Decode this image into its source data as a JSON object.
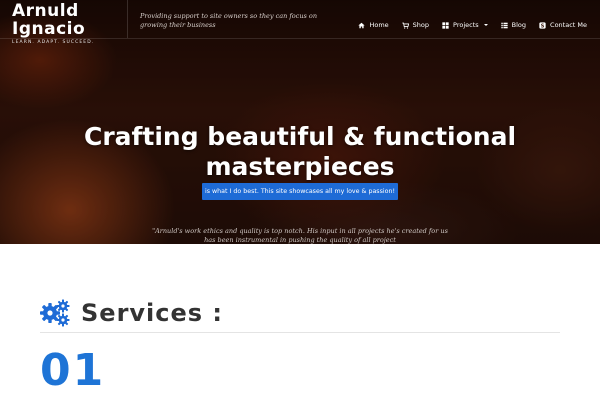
{
  "header": {
    "brand_name": "Arnuld Ignacio",
    "brand_tagline": "LEARN. ADAPT. SUCCEED.",
    "site_description": "Providing support to site owners so they can focus on growing their business"
  },
  "nav": {
    "items": [
      {
        "label": "Home",
        "icon": "home-icon"
      },
      {
        "label": "Shop",
        "icon": "cart-icon"
      },
      {
        "label": "Projects",
        "icon": "grid-icon",
        "has_dropdown": true
      },
      {
        "label": "Blog",
        "icon": "list-icon"
      },
      {
        "label": "Contact Me",
        "icon": "skype-icon"
      }
    ]
  },
  "hero": {
    "title": "Crafting beautiful & functional masterpieces",
    "cta_label": "is what I do best. This site showcases all my love & passion!",
    "quote": "\"Arnuld's work ethics and quality is top notch. His input in all projects he's created for us has been instrumental in pushing the quality of all project"
  },
  "services": {
    "title": "Services :",
    "icon": "gears-icon",
    "first_number": "01"
  },
  "colors": {
    "accent": "#1e6bd6",
    "number": "#1e74d6",
    "heading": "#333333"
  }
}
